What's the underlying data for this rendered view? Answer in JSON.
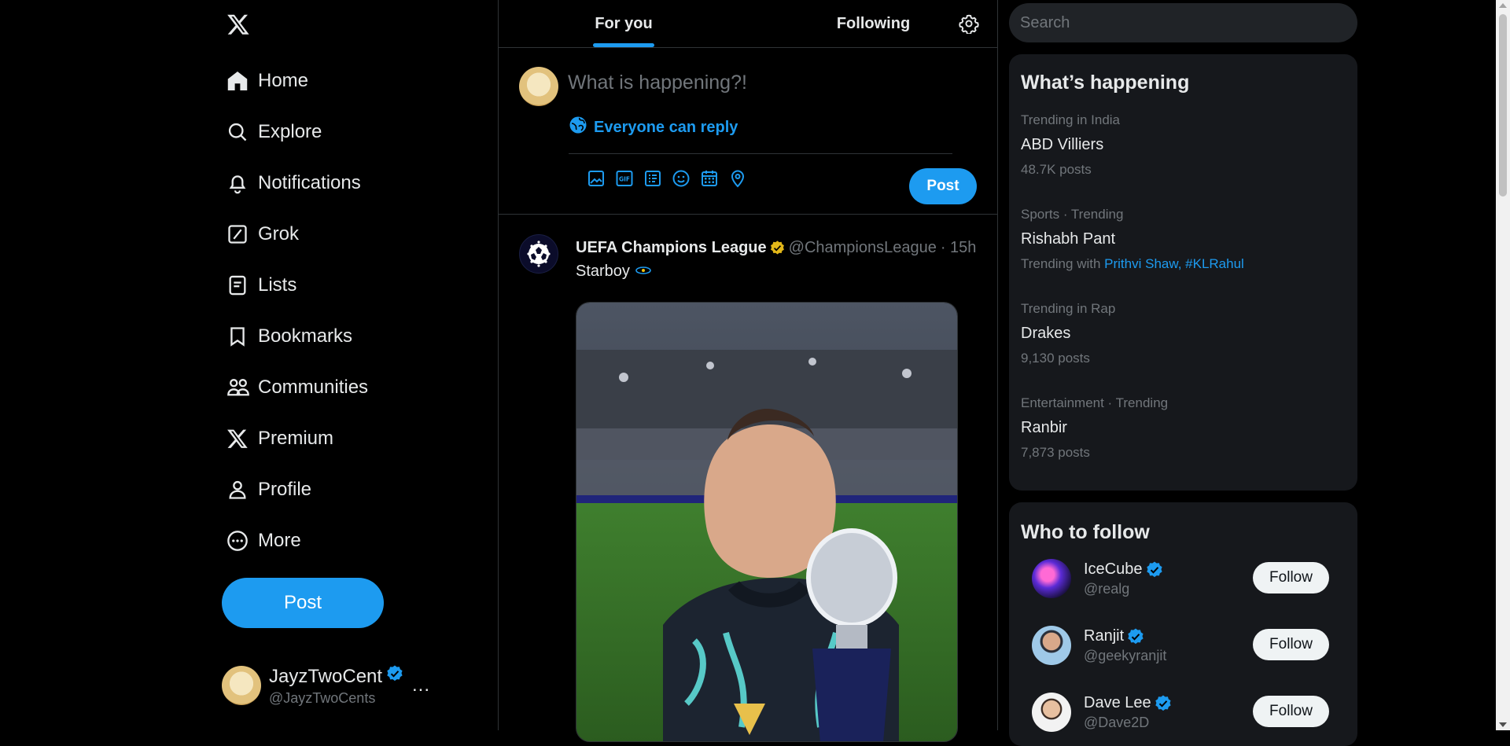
{
  "nav": {
    "items": [
      {
        "label": "Home",
        "icon": "home-icon"
      },
      {
        "label": "Explore",
        "icon": "search-icon"
      },
      {
        "label": "Notifications",
        "icon": "bell-icon"
      },
      {
        "label": "Grok",
        "icon": "grok-icon"
      },
      {
        "label": "Lists",
        "icon": "list-icon"
      },
      {
        "label": "Bookmarks",
        "icon": "bookmark-icon"
      },
      {
        "label": "Communities",
        "icon": "people-icon"
      },
      {
        "label": "Premium",
        "icon": "x-logo-icon"
      },
      {
        "label": "Profile",
        "icon": "person-icon"
      },
      {
        "label": "More",
        "icon": "more-circle-icon"
      }
    ],
    "post_label": "Post"
  },
  "me": {
    "name": "JayzTwoCent",
    "handle": "@JayzTwoCents",
    "more": "..."
  },
  "timeline": {
    "tabs": {
      "for_you": "For you",
      "following": "Following"
    }
  },
  "composer": {
    "placeholder": "What is happening?!",
    "reply_setting": "Everyone can reply",
    "post_label": "Post",
    "tools": [
      "image-icon",
      "gif-icon",
      "poll-icon",
      "emoji-icon",
      "schedule-icon",
      "location-icon"
    ]
  },
  "tweet": {
    "name": "UEFA Champions League",
    "handle": "@ChampionsLeague",
    "time": "· 15h",
    "text": "Starboy"
  },
  "search": {
    "placeholder": "Search"
  },
  "whats_happening": {
    "title": "What’s happening",
    "trends": [
      {
        "meta": "Trending in India",
        "name": "ABD Villiers",
        "foot": "48.7K posts"
      },
      {
        "meta": "Sports · Trending",
        "name": "Rishabh Pant",
        "foot_prefix": "Trending with ",
        "foot_link": "Prithvi Shaw, #KLRahul"
      },
      {
        "meta": "Trending in Rap",
        "name": "Drakes",
        "foot": "9,130 posts"
      },
      {
        "meta": "Entertainment · Trending",
        "name": "Ranbir",
        "foot": "7,873 posts"
      }
    ]
  },
  "who_to_follow": {
    "title": "Who to follow",
    "users": [
      {
        "name": "IceCube",
        "handle": "@realg",
        "button": "Follow"
      },
      {
        "name": "Ranjit",
        "handle": "@geekyranjit",
        "button": "Follow"
      },
      {
        "name": "Dave Lee",
        "handle": "@Dave2D",
        "button": "Follow"
      }
    ]
  },
  "colors": {
    "accent": "#1d9bf0",
    "background": "#000000",
    "card": "#16181c",
    "verified": "#1d9bf0",
    "gold_badge": "#e2b719"
  }
}
